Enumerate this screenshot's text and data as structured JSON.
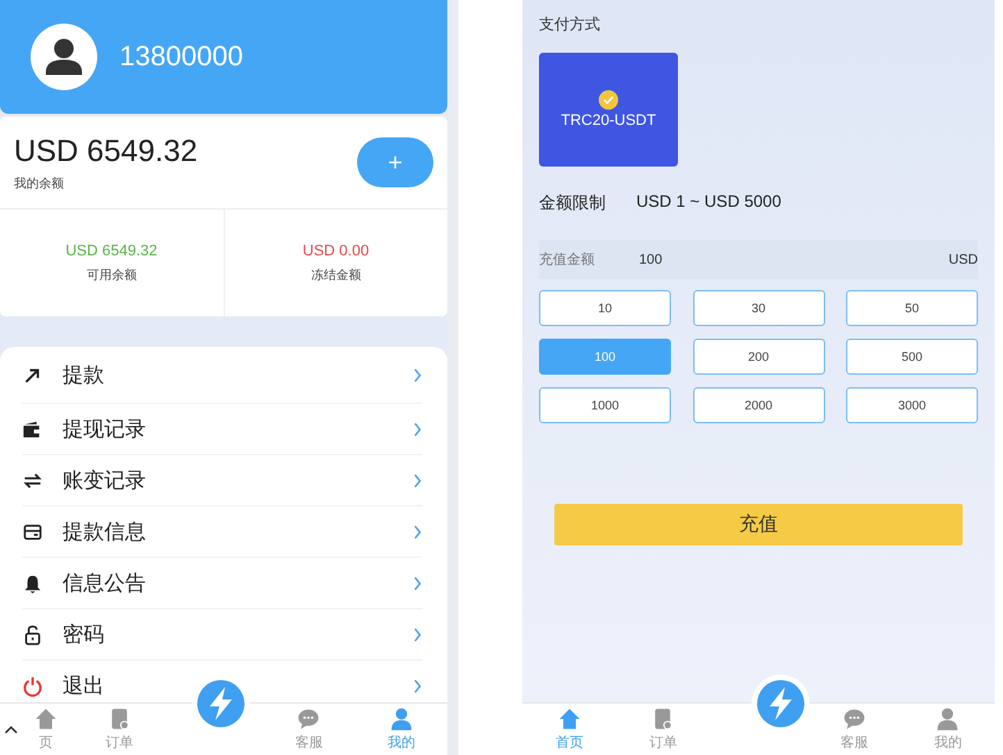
{
  "left_screen": {
    "header": {
      "account": "13800000"
    },
    "balance": {
      "amount": "USD 6549.32",
      "label": "我的余额",
      "add_button": "+"
    },
    "funds": [
      {
        "amount": "USD 6549.32",
        "label": "可用余额",
        "color": "#58b548"
      },
      {
        "amount": "USD 0.00",
        "label": "冻结金额",
        "color": "#e8494b"
      }
    ],
    "menu": [
      {
        "label": "提款"
      },
      {
        "label": "提现记录"
      },
      {
        "label": "账变记录"
      },
      {
        "label": "提款信息"
      },
      {
        "label": "信息公告"
      },
      {
        "label": "密码"
      },
      {
        "label": "退出"
      }
    ],
    "tab_bar": [
      {
        "label": "页",
        "selected": false
      },
      {
        "label": "订单",
        "selected": false
      },
      {
        "label": "客服",
        "selected": false
      },
      {
        "label": "我的",
        "selected": true
      }
    ]
  },
  "right_screen": {
    "payment_label": "支付方式",
    "payment_methods": [
      {
        "label": "TRC20-USDT",
        "selected": true
      }
    ],
    "limit": {
      "label": "金额限制",
      "value": "USD 1 ~ USD 5000"
    },
    "amount_field": {
      "label": "充值金额",
      "value": "100",
      "unit": "USD"
    },
    "amounts": [
      {
        "label": "10",
        "selected": false
      },
      {
        "label": "30",
        "selected": false
      },
      {
        "label": "50",
        "selected": false
      },
      {
        "label": "100",
        "selected": true
      },
      {
        "label": "200",
        "selected": false
      },
      {
        "label": "500",
        "selected": false
      },
      {
        "label": "1000",
        "selected": false
      },
      {
        "label": "2000",
        "selected": false
      },
      {
        "label": "3000",
        "selected": false
      }
    ],
    "submit": "充值",
    "tab_bar": [
      {
        "label": "首页",
        "selected": true
      },
      {
        "label": "订单",
        "selected": false
      },
      {
        "label": "客服",
        "selected": false
      },
      {
        "label": "我的",
        "selected": false
      }
    ]
  }
}
